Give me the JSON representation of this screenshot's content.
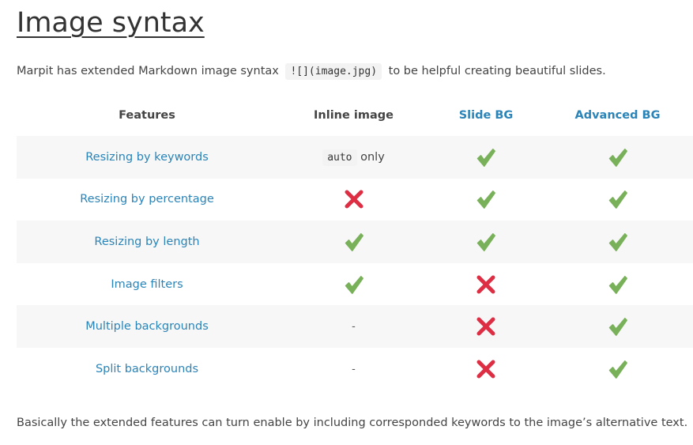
{
  "heading": "Image syntax",
  "intro": {
    "before": "Marpit has extended Markdown image syntax",
    "code": "![](image.jpg)",
    "after": "to be helpful creating beautiful slides."
  },
  "table": {
    "headers": [
      "Features",
      "Inline image",
      "Slide BG",
      "Advanced BG"
    ],
    "rows": [
      {
        "feature": "Resizing by keywords",
        "inline_code": "auto",
        "inline_text": "only",
        "slide_bg": "check",
        "advanced_bg": "check"
      },
      {
        "feature": "Resizing by percentage",
        "inline": "cross",
        "slide_bg": "check",
        "advanced_bg": "check"
      },
      {
        "feature": "Resizing by length",
        "inline": "check",
        "slide_bg": "check",
        "advanced_bg": "check"
      },
      {
        "feature": "Image filters",
        "inline": "check",
        "slide_bg": "cross",
        "advanced_bg": "check"
      },
      {
        "feature": "Multiple backgrounds",
        "inline": "-",
        "slide_bg": "cross",
        "advanced_bg": "check"
      },
      {
        "feature": "Split backgrounds",
        "inline": "-",
        "slide_bg": "cross",
        "advanced_bg": "check"
      }
    ]
  },
  "outro": "Basically the extended features can turn enable by including corresponded keywords to the image’s alternative text.",
  "colors": {
    "link": "#2a84b8",
    "check": "#78b159",
    "cross": "#dd2e44",
    "stripe": "#f7f7f7"
  },
  "icons": {
    "check": "heavy-check-mark-icon",
    "cross": "cross-mark-icon"
  }
}
